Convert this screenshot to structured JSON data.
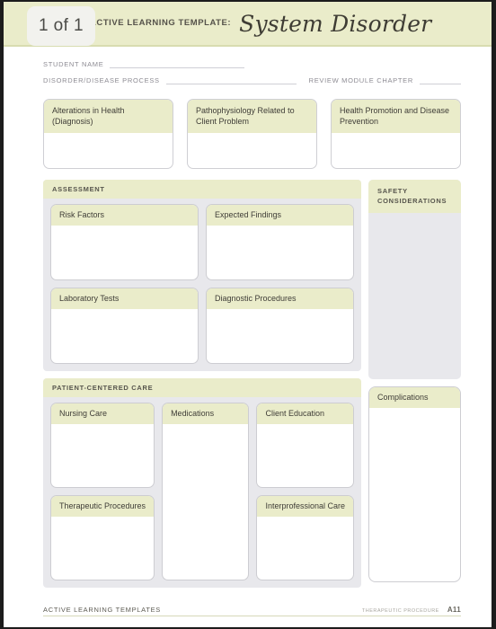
{
  "header": {
    "page_badge": "1 of 1",
    "kicker": "ACTIVE LEARNING TEMPLATE:",
    "title": "System Disorder"
  },
  "meta": {
    "student_name_label": "STUDENT NAME",
    "disorder_label": "DISORDER/DISEASE PROCESS",
    "review_chapter_label": "REVIEW MODULE CHAPTER",
    "student_name_value": "",
    "disorder_value": "",
    "review_chapter_value": ""
  },
  "top_boxes": [
    {
      "label": "Alterations in Health (Diagnosis)",
      "value": ""
    },
    {
      "label": "Pathophysiology Related to Client Problem",
      "value": ""
    },
    {
      "label": "Health Promotion and Disease Prevention",
      "value": ""
    }
  ],
  "assessment": {
    "section_label": "ASSESSMENT",
    "boxes": [
      {
        "label": "Risk Factors",
        "value": ""
      },
      {
        "label": "Expected Findings",
        "value": ""
      },
      {
        "label": "Laboratory Tests",
        "value": ""
      },
      {
        "label": "Diagnostic Procedures",
        "value": ""
      }
    ]
  },
  "patient_centered_care": {
    "section_label": "PATIENT-CENTERED CARE",
    "boxes": [
      {
        "label": "Nursing Care",
        "value": ""
      },
      {
        "label": "Therapeutic Procedures",
        "value": ""
      },
      {
        "label": "Medications",
        "value": ""
      },
      {
        "label": "Client Education",
        "value": ""
      },
      {
        "label": "Interprofessional Care",
        "value": ""
      }
    ]
  },
  "safety": {
    "label_line1": "SAFETY",
    "label_line2": "CONSIDERATIONS",
    "value": ""
  },
  "complications": {
    "label": "Complications",
    "value": ""
  },
  "footer": {
    "left": "ACTIVE LEARNING TEMPLATES",
    "right": "THERAPEUTIC PROCEDURE",
    "code": "A11"
  },
  "colors": {
    "band_green": "#eaecca",
    "panel_gray": "#e8e8ec",
    "box_white": "#ffffff",
    "border_gray": "#cdcdd2",
    "text_dark": "#3f3d37",
    "page_border": "#1c1c1c"
  }
}
